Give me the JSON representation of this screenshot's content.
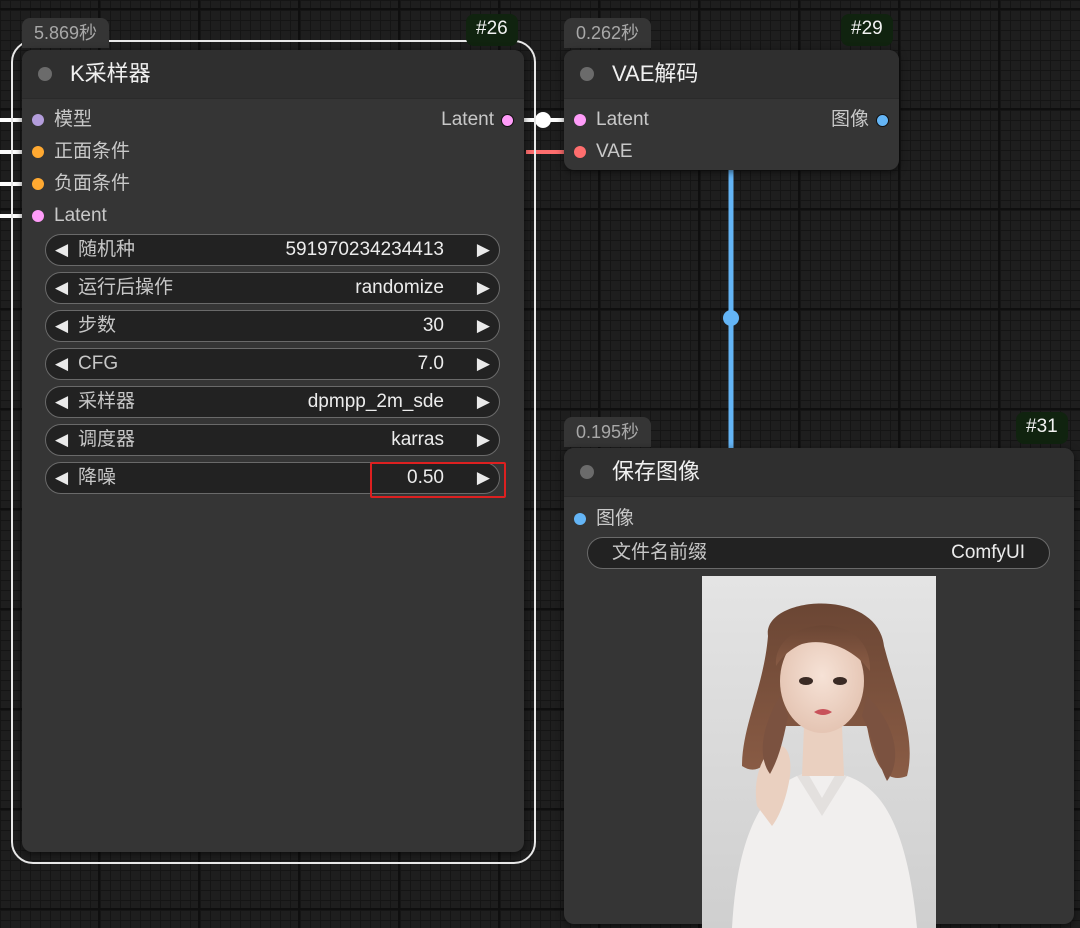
{
  "nodes": {
    "ksampler": {
      "time": "5.869秒",
      "id": "#26",
      "title": "K采样器",
      "inputs": [
        {
          "label": "模型",
          "color": "#b39ddb"
        },
        {
          "label": "正面条件",
          "color": "#ffa931"
        },
        {
          "label": "负面条件",
          "color": "#ffa931"
        },
        {
          "label": "Latent",
          "color": "#ff9cf9"
        }
      ],
      "output": {
        "label": "Latent",
        "color": "#ff9cf9"
      },
      "widgets": [
        {
          "label": "随机种",
          "value": "591970234234413"
        },
        {
          "label": "运行后操作",
          "value": "randomize"
        },
        {
          "label": "步数",
          "value": "30"
        },
        {
          "label": "CFG",
          "value": "7.0"
        },
        {
          "label": "采样器",
          "value": "dpmpp_2m_sde"
        },
        {
          "label": "调度器",
          "value": "karras"
        },
        {
          "label": "降噪",
          "value": "0.50"
        }
      ]
    },
    "vae_decode": {
      "time": "0.262秒",
      "id": "#29",
      "title": "VAE解码",
      "inputs": [
        {
          "label": "Latent",
          "color": "#ff9cf9"
        },
        {
          "label": "VAE",
          "color": "#ff6e6e"
        }
      ],
      "output": {
        "label": "图像",
        "color": "#64b5f6"
      }
    },
    "save_image": {
      "time": "0.195秒",
      "id": "#31",
      "title": "保存图像",
      "inputs": [
        {
          "label": "图像",
          "color": "#64b5f6"
        }
      ],
      "widgets": [
        {
          "label": "文件名前缀",
          "value": "ComfyUI"
        }
      ]
    }
  },
  "icons": {
    "decrement": "◀",
    "increment": "▶"
  },
  "colors": {
    "link_latent": "#ffffff",
    "link_vae": "#ff6e6e",
    "link_image": "#64b5f6",
    "highlight": "#dd2020"
  }
}
